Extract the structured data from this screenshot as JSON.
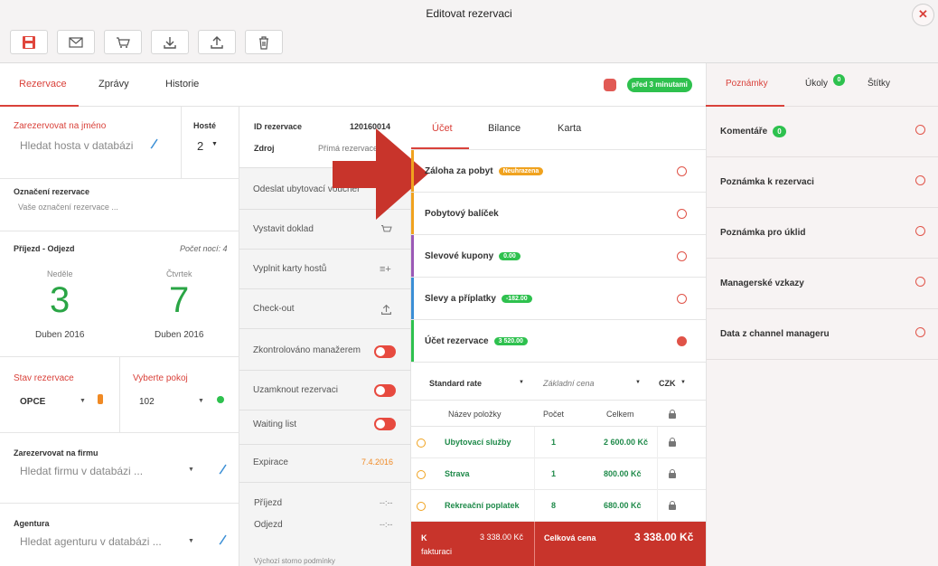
{
  "window": {
    "title": "Editovat rezervaci",
    "close": "✕"
  },
  "toolbar": [
    {
      "icon": "save-icon"
    },
    {
      "icon": "mail-icon"
    },
    {
      "icon": "cart-icon"
    },
    {
      "icon": "download-icon"
    },
    {
      "icon": "upload-icon"
    },
    {
      "icon": "trash-icon"
    }
  ],
  "tabs": {
    "rezervace": "Rezervace",
    "zpravy": "Zprávy",
    "historie": "Historie"
  },
  "status": {
    "time_badge": "před 3 minutami",
    "dot_color": "#e15a55"
  },
  "guest": {
    "label": "Zarezervovat na jméno",
    "placeholder": "Hledat hosta v databázi",
    "guests_label": "Hosté",
    "guests_value": "2"
  },
  "tag": {
    "label": "Označení rezervace",
    "placeholder": "Vaše označení rezervace ..."
  },
  "dates": {
    "label": "Příjezd - Odjezd",
    "nights": "Počet nocí: 4",
    "arr_day": "Neděle",
    "arr_num": "3",
    "arr_month": "Duben 2016",
    "dep_day": "Čtvrtek",
    "dep_num": "7",
    "dep_month": "Duben 2016"
  },
  "state": {
    "label": "Stav rezervace",
    "value": "OPCE",
    "room_label": "Vyberte pokoj",
    "room_value": "102"
  },
  "company": {
    "label": "Zarezervovat na firmu",
    "placeholder": "Hledat firmu v databázi ..."
  },
  "agency": {
    "label": "Agentura",
    "placeholder": "Hledat agenturu v databázi ..."
  },
  "info": {
    "id_label": "ID rezervace",
    "id_value": "120160014",
    "source_label": "Zdroj",
    "source_value": "Přímá rezervace"
  },
  "actions": {
    "voucher": "Odeslat ubytovací voucher",
    "doklad": "Vystavit doklad",
    "karty": "Vyplnit karty hostů",
    "checkout": "Check-out",
    "zkontrolovano": "Zkontrolováno manažerem",
    "uzamknout": "Uzamknout rezervaci",
    "waiting": "Waiting list",
    "expirace_label": "Expirace",
    "expirace_value": "7.4.2016",
    "prijezd": "Příjezd",
    "odjezd": "Odjezd",
    "prijezd_val": "--:--",
    "odjezd_val": "--:--",
    "footer_text": "Výchozí storno podmínky"
  },
  "account": {
    "tabs": {
      "ucet": "Účet",
      "bilance": "Bilance",
      "karta": "Karta"
    },
    "sections": [
      {
        "label": "Záloha za pobyt",
        "badge": "Neuhrazena",
        "badge_color": "#f0a21e",
        "bar": "#f0a21e"
      },
      {
        "label": "Pobytový balíček",
        "badge": "",
        "bar": "#f0a21e"
      },
      {
        "label": "Slevové kupony",
        "badge": "0.00",
        "badge_color": "#2ec14e",
        "bar": "#9b59b6"
      },
      {
        "label": "Slevy a příplatky",
        "badge": "-182.00",
        "badge_color": "#2ec14e",
        "bar": "#3b8fd6"
      },
      {
        "label": "Účet rezervace",
        "badge": "3 520.00",
        "badge_color": "#2ec14e",
        "bar": "#2ec14e"
      }
    ],
    "rate": "Standard rate",
    "price_type": "Základní cena",
    "currency": "CZK",
    "columns": {
      "name": "Název položky",
      "count": "Počet",
      "total": "Celkem"
    },
    "rows": [
      {
        "name": "Ubytovací služby",
        "count": "1",
        "total": "2 600.00 Kč"
      },
      {
        "name": "Strava",
        "count": "1",
        "total": "800.00 Kč"
      },
      {
        "name": "Rekreační poplatek",
        "count": "8",
        "total": "680.00 Kč"
      }
    ],
    "invoice_label_1": "K",
    "invoice_label_2": "fakturaci",
    "invoice_value": "3 338.00 Kč",
    "total_label": "Celková cena",
    "total_value": "3 338.00 Kč"
  },
  "right": {
    "tabs": {
      "poznamky": "Poznámky",
      "ukoly": "Úkoly",
      "ukoly_count": "0",
      "stitky": "Štítky"
    },
    "items": [
      {
        "label": "Komentáře",
        "badge": "0"
      },
      {
        "label": "Poznámka k rezervaci"
      },
      {
        "label": "Poznámka pro úklid"
      },
      {
        "label": "Managerské vzkazy"
      },
      {
        "label": "Data z channel manageru"
      }
    ]
  }
}
